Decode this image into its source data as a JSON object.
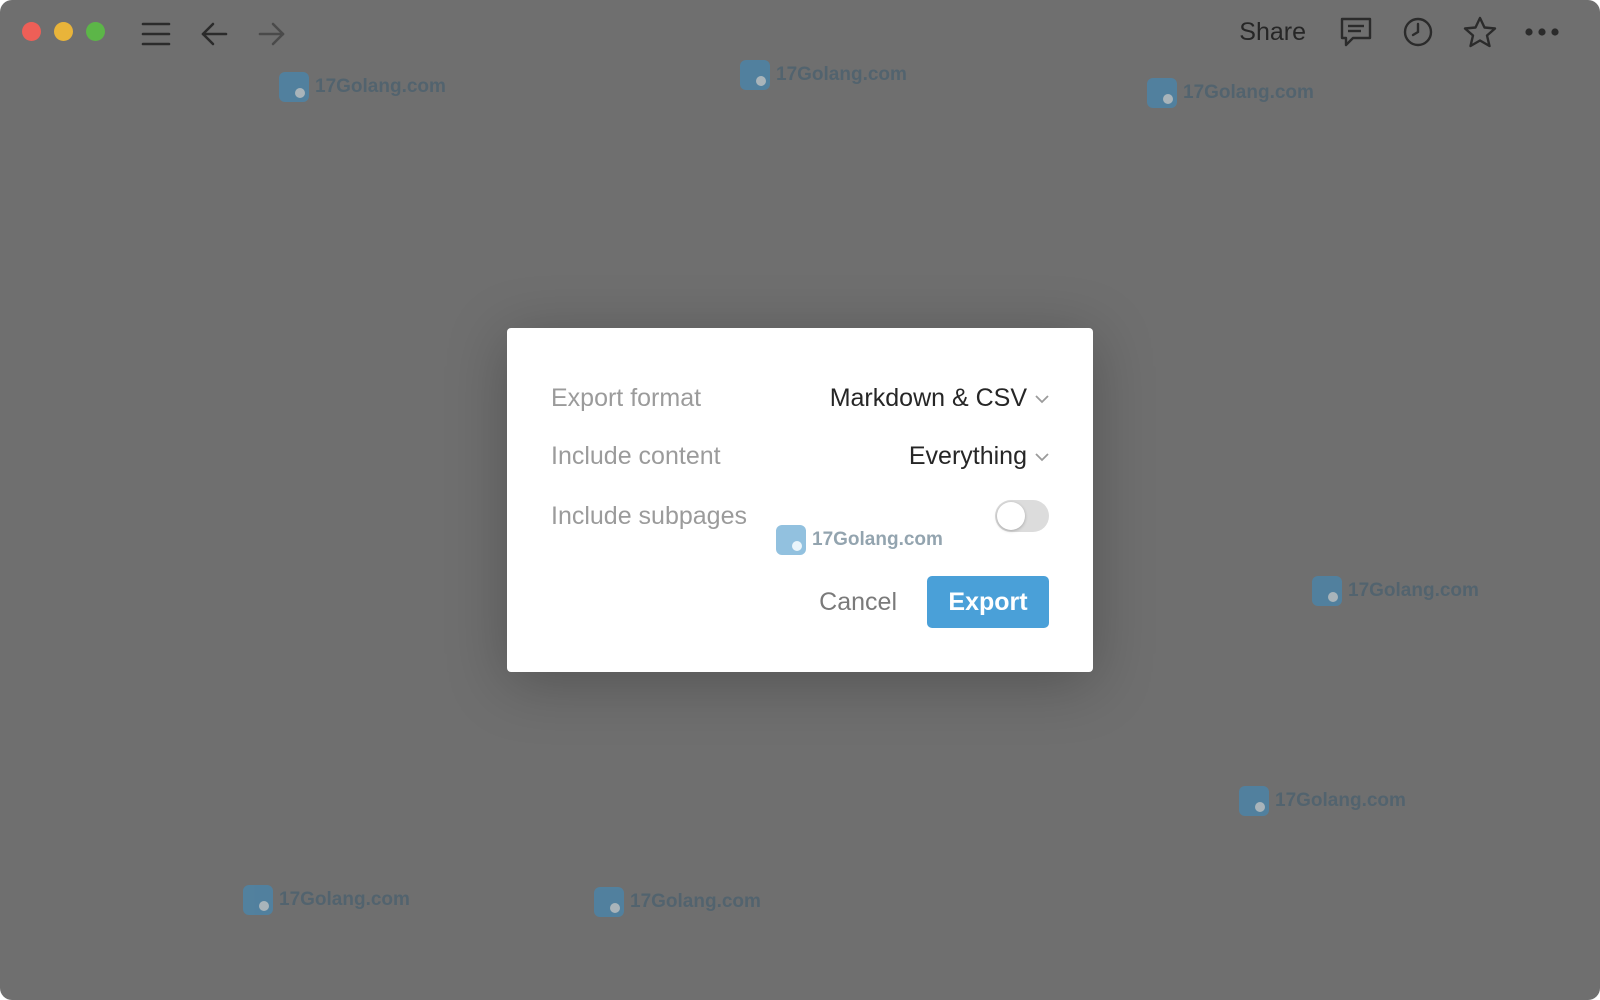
{
  "window": {
    "background": "#6f6f6f"
  },
  "toolbar": {
    "share_label": "Share",
    "icons": [
      "sidebar-menu-icon",
      "back-arrow-icon",
      "forward-arrow-icon",
      "comments-icon",
      "history-clock-icon",
      "favorite-star-icon",
      "more-options-icon"
    ]
  },
  "watermark": {
    "text": "17Golang.com"
  },
  "dialog": {
    "rows": [
      {
        "label": "Export format",
        "value": "Markdown & CSV"
      },
      {
        "label": "Include content",
        "value": "Everything"
      },
      {
        "label": "Include subpages",
        "toggle_on": false
      }
    ],
    "cancel_label": "Cancel",
    "export_label": "Export",
    "accent": "#4aa0d8"
  }
}
